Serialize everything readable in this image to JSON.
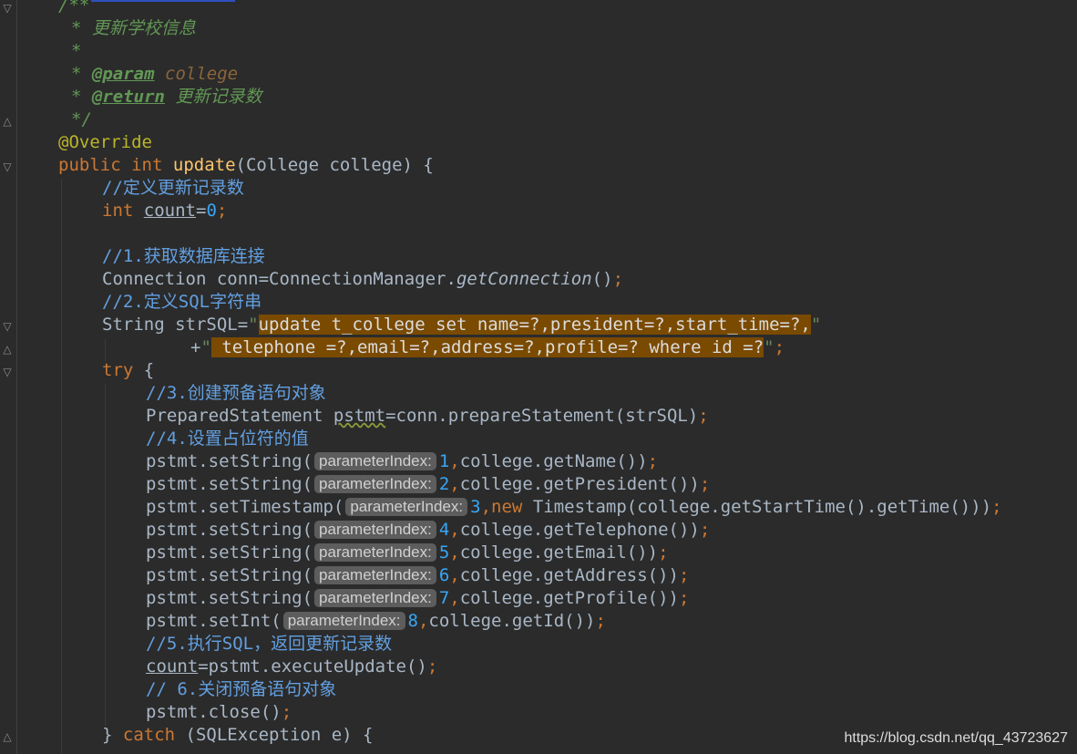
{
  "watermark": "https://blog.csdn.net/qq_43723627",
  "code": {
    "doc_open": "/**",
    "doc_star": "*",
    "doc_close": "*/",
    "doc_title": "更新学校信息",
    "tag_param": "@param",
    "param_name": "college",
    "tag_return": "@return",
    "return_desc": "更新记录数",
    "annotation": "@Override",
    "kw_public": "public",
    "kw_int": "int",
    "kw_try": "try",
    "kw_new": "new",
    "kw_catch": "catch",
    "method_name": "update",
    "method_params": "(College college) {",
    "comment_count": "//定义更新记录数",
    "var_count": "count",
    "zero": "0",
    "comment_1": "//1.获取数据库连接",
    "conn_decl": "Connection conn=ConnectionManager.",
    "get_connection": "getConnection",
    "comment_2": "//2.定义SQL字符串",
    "str_decl": "String strSQL=",
    "sql_part1": "update t_college set name=?,president=?,start_time=?,",
    "sql_part2": " telephone =?,email=?,address=?,profile=? where id =?",
    "comment_3": "//3.创建预备语句对象",
    "ps_type": "PreparedStatement ",
    "ps_var": "pstmt",
    "ps_assign": "=conn.prepareStatement(strSQL)",
    "comment_4": "//4.设置占位符的值",
    "param_hint": "parameterIndex:",
    "setters": [
      {
        "call": "pstmt.setString(",
        "index": "1",
        "arg": "college.getName())"
      },
      {
        "call": "pstmt.setString(",
        "index": "2",
        "arg": "college.getPresident())"
      },
      {
        "call": "pstmt.setTimestamp(",
        "index": "3",
        "arg_pre_kw": "",
        "arg_kw": "new",
        "arg": " Timestamp(college.getStartTime().getTime()))"
      },
      {
        "call": "pstmt.setString(",
        "index": "4",
        "arg": "college.getTelephone())"
      },
      {
        "call": "pstmt.setString(",
        "index": "5",
        "arg": "college.getEmail())"
      },
      {
        "call": "pstmt.setString(",
        "index": "6",
        "arg": "college.getAddress())"
      },
      {
        "call": "pstmt.setString(",
        "index": "7",
        "arg": "college.getProfile())"
      },
      {
        "call": "pstmt.setInt(",
        "index": "8",
        "arg": "college.getId())"
      }
    ],
    "comment_5": "//5.执行SQL，返回更新记录数",
    "exec_rest": "=pstmt.executeUpdate()",
    "comment_6": "// 6.关闭预备语句对象",
    "close_call": "pstmt.close()",
    "catch_rest": " (SQLException e) {",
    "brace_close": "}",
    "brace_open": "{",
    "semicolon": ";",
    "comma": ",",
    "eq": "=",
    "plus": "+",
    "quote": "\"",
    "open_paren": "(",
    "close_paren": ")"
  }
}
